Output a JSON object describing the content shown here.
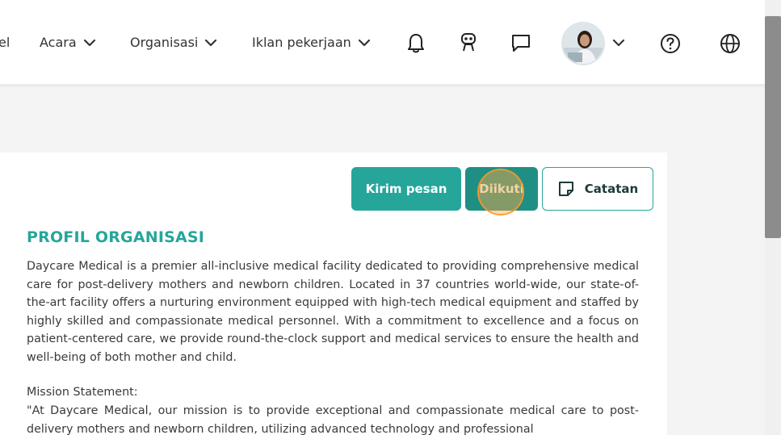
{
  "nav": {
    "partial_label": "el",
    "items": [
      {
        "label": "Acara"
      },
      {
        "label": "Organisasi"
      },
      {
        "label": "Iklan pekerjaan"
      }
    ],
    "icons": [
      "bell-icon",
      "robot-icon",
      "chat-icon",
      "chevron-down-icon",
      "help-icon",
      "globe-icon"
    ]
  },
  "actions": {
    "send_message": "Kirim pesan",
    "following": "Diikuti",
    "notes": "Catatan"
  },
  "profile": {
    "title": "PROFIL ORGANISASI",
    "description": "Daycare Medical is a premier all-inclusive medical facility dedicated to providing comprehensive medical care for post-delivery mothers and newborn children. Located in 37 countries world-wide, our state-of-the-art facility offers a nurturing environment equipped with high-tech medical equipment and staffed by highly skilled and compassionate medical personnel. With a commitment to excellence and a focus on patient-centered care, we provide round-the-clock support and medical services to ensure the health and well-being of both mother and child.",
    "mission_label": "Mission Statement:",
    "mission_text": "\"At Daycare Medical, our mission is to provide exceptional and compassionate medical care to post-delivery mothers and newborn children, utilizing advanced technology and professional"
  },
  "colors": {
    "accent": "#26a69a",
    "accent_dark": "#1f8f84",
    "click_marker": "#ffaa46"
  }
}
